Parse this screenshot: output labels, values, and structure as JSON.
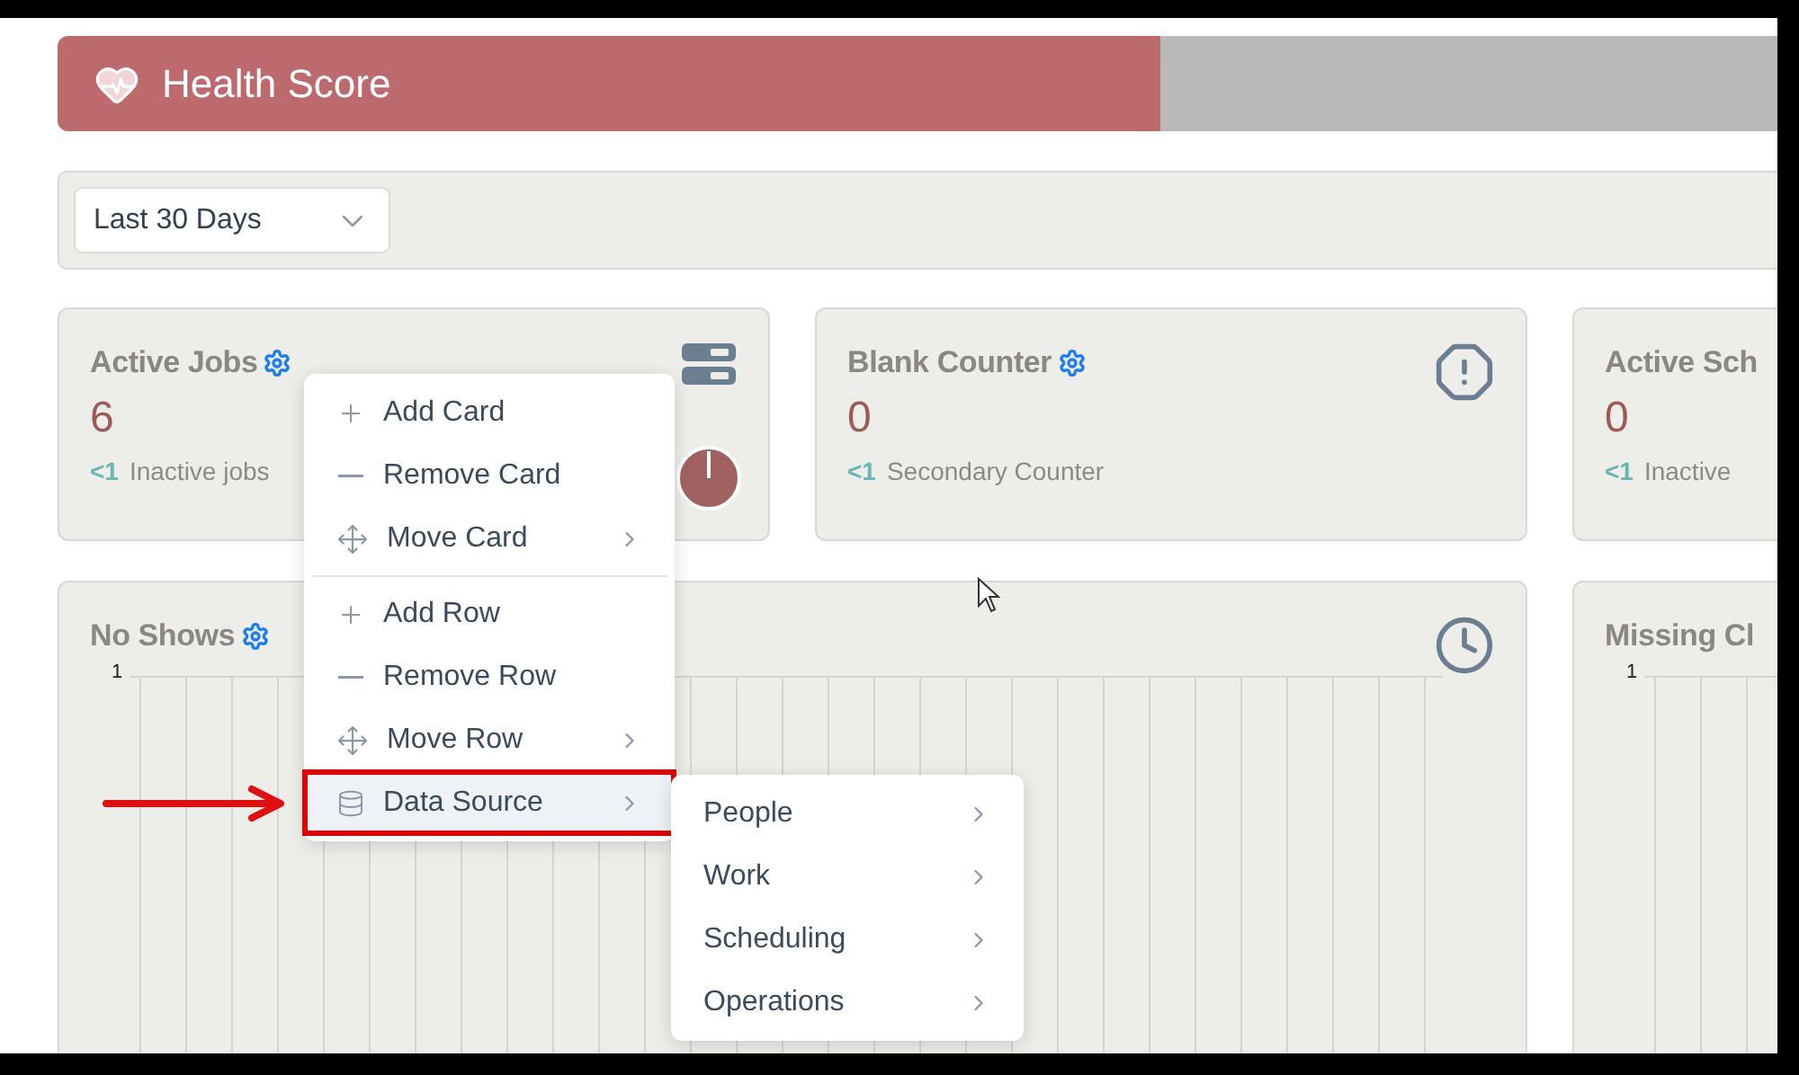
{
  "health_bar": {
    "title": "Health Score",
    "level": 0.625
  },
  "filter": {
    "value": "Last 30 Days"
  },
  "counter_cards": [
    {
      "title": "Active Jobs",
      "settings": true,
      "value": "6",
      "delta": "<1",
      "caption": "Inactive jobs",
      "kind": "server"
    },
    {
      "title": "Blank Counter",
      "settings": true,
      "value": "0",
      "delta": "<1",
      "caption": "Secondary Counter",
      "kind": "alert"
    },
    {
      "title": "Active Sch",
      "settings": false,
      "value": "0",
      "delta": "<1",
      "caption": "Inactive",
      "kind": "plain"
    }
  ],
  "chart_cards": [
    {
      "title": "No Shows",
      "settings": true,
      "kind": "clock",
      "y_tick": "1"
    },
    {
      "title": "Missing Cl",
      "settings": false,
      "kind": "plain",
      "y_tick": "1"
    }
  ],
  "context_menu": {
    "sections": [
      [
        {
          "label": "Add Card",
          "kind": "plus",
          "has_submenu": false,
          "selected": false
        },
        {
          "label": "Remove Card",
          "kind": "minus",
          "has_submenu": false,
          "selected": false
        },
        {
          "label": "Move Card",
          "kind": "move",
          "has_submenu": true,
          "selected": false
        }
      ],
      [
        {
          "label": "Add Row",
          "kind": "plus",
          "has_submenu": false,
          "selected": false
        },
        {
          "label": "Remove Row",
          "kind": "minus",
          "has_submenu": false,
          "selected": false
        },
        {
          "label": "Move Row",
          "kind": "move",
          "has_submenu": true,
          "selected": false
        },
        {
          "label": "Data Source",
          "kind": "database",
          "has_submenu": true,
          "selected": true
        }
      ]
    ]
  },
  "submenu": {
    "items": [
      {
        "label": "People",
        "has_submenu": true
      },
      {
        "label": "Work",
        "has_submenu": true
      },
      {
        "label": "Scheduling",
        "has_submenu": true
      },
      {
        "label": "Operations",
        "has_submenu": true
      }
    ]
  }
}
